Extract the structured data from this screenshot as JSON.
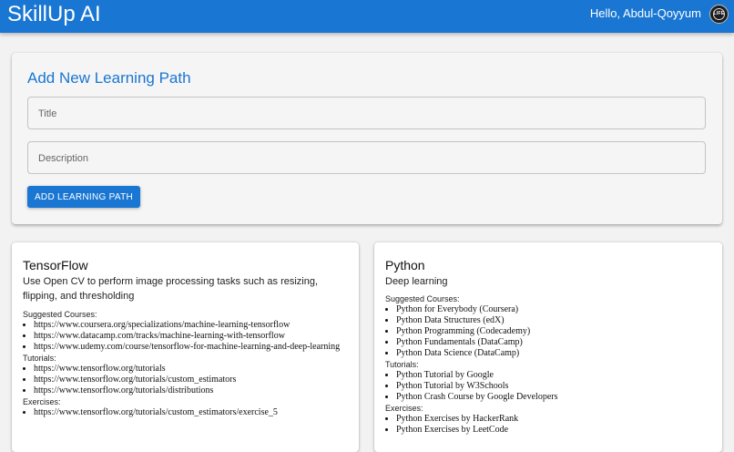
{
  "header": {
    "brand": "SkillUp AI",
    "greeting": "Hello, Abdul-Qoyyum",
    "avatar_text": "LIFE"
  },
  "form": {
    "title": "Add New Learning Path",
    "title_placeholder": "Title",
    "description_placeholder": "Description",
    "submit_label": "ADD LEARNING PATH"
  },
  "cards": [
    {
      "title": "TensorFlow",
      "description": "Use Open CV to perform image processing tasks such as resizing, flipping, and thresholding",
      "suggested_label": "Suggested Courses:",
      "courses": [
        "https://www.coursera.org/specializations/machine-learning-tensorflow",
        "https://www.datacamp.com/tracks/machine-learning-with-tensorflow",
        "https://www.udemy.com/course/tensorflow-for-machine-learning-and-deep-learning"
      ],
      "tutorials_label": "Tutorials:",
      "tutorials": [
        "https://www.tensorflow.org/tutorials",
        "https://www.tensorflow.org/tutorials/custom_estimators",
        "https://www.tensorflow.org/tutorials/distributions"
      ],
      "exercises_label": "Exercises:",
      "exercises": [
        "https://www.tensorflow.org/tutorials/custom_estimators/exercise_5"
      ]
    },
    {
      "title": "Python",
      "description": "Deep learning",
      "suggested_label": "Suggested Courses:",
      "courses": [
        "Python for Everybody (Coursera)",
        "Python Data Structures (edX)",
        "Python Programming (Codecademy)",
        "Python Fundamentals (DataCamp)",
        "Python Data Science (DataCamp)"
      ],
      "tutorials_label": "Tutorials:",
      "tutorials": [
        "Python Tutorial by Google",
        "Python Tutorial by W3Schools",
        "Python Crash Course by Google Developers"
      ],
      "exercises_label": "Exercises:",
      "exercises": [
        "Python Exercises by HackerRank",
        "Python Exercises by LeetCode"
      ]
    }
  ]
}
